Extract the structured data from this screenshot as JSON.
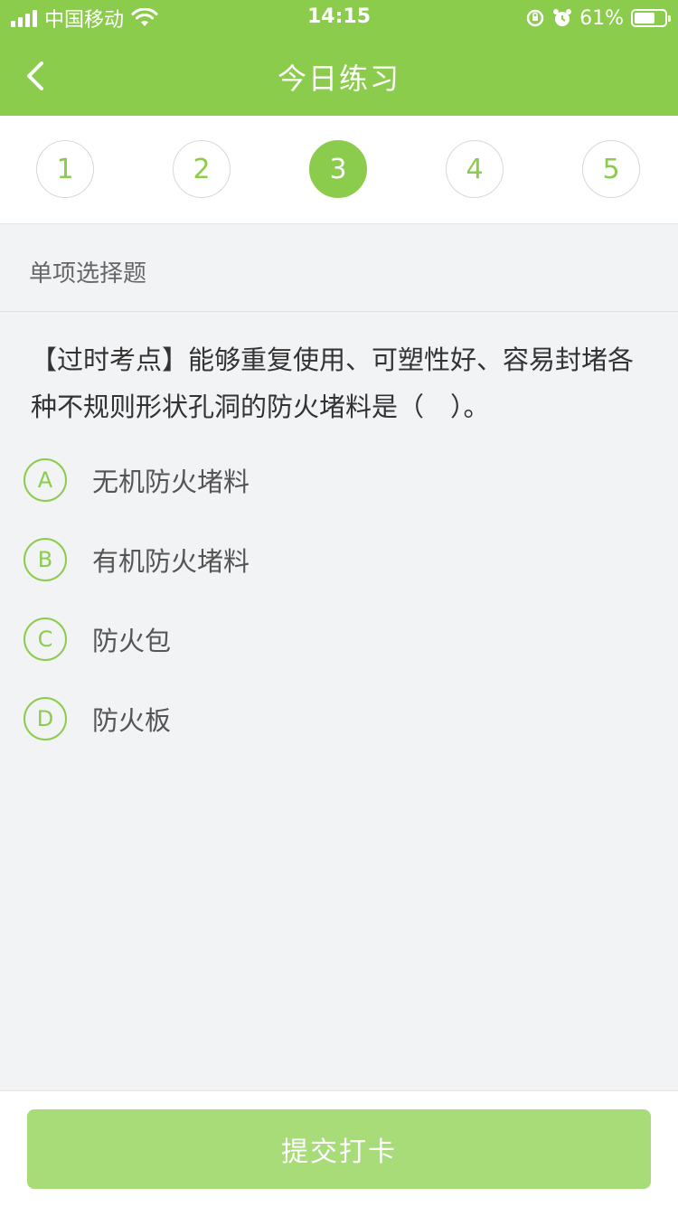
{
  "status_bar": {
    "carrier": "中国移动",
    "time": "14:15",
    "battery_percent": "61%"
  },
  "header": {
    "title": "今日练习",
    "back_icon": "chevron-left-icon"
  },
  "steps": [
    {
      "label": "1",
      "active": false
    },
    {
      "label": "2",
      "active": false
    },
    {
      "label": "3",
      "active": true
    },
    {
      "label": "4",
      "active": false
    },
    {
      "label": "5",
      "active": false
    }
  ],
  "question": {
    "type": "单项选择题",
    "text": "【过时考点】能够重复使用、可塑性好、容易封堵各种不规则形状孔洞的防火堵料是（　）。",
    "options": [
      {
        "letter": "A",
        "text": "无机防火堵料"
      },
      {
        "letter": "B",
        "text": "有机防火堵料"
      },
      {
        "letter": "C",
        "text": "防火包"
      },
      {
        "letter": "D",
        "text": "防火板"
      }
    ]
  },
  "footer": {
    "submit_label": "提交打卡"
  },
  "colors": {
    "accent": "#8bcc4c",
    "button_disabled": "#a8dc78",
    "background": "#f2f3f5"
  }
}
